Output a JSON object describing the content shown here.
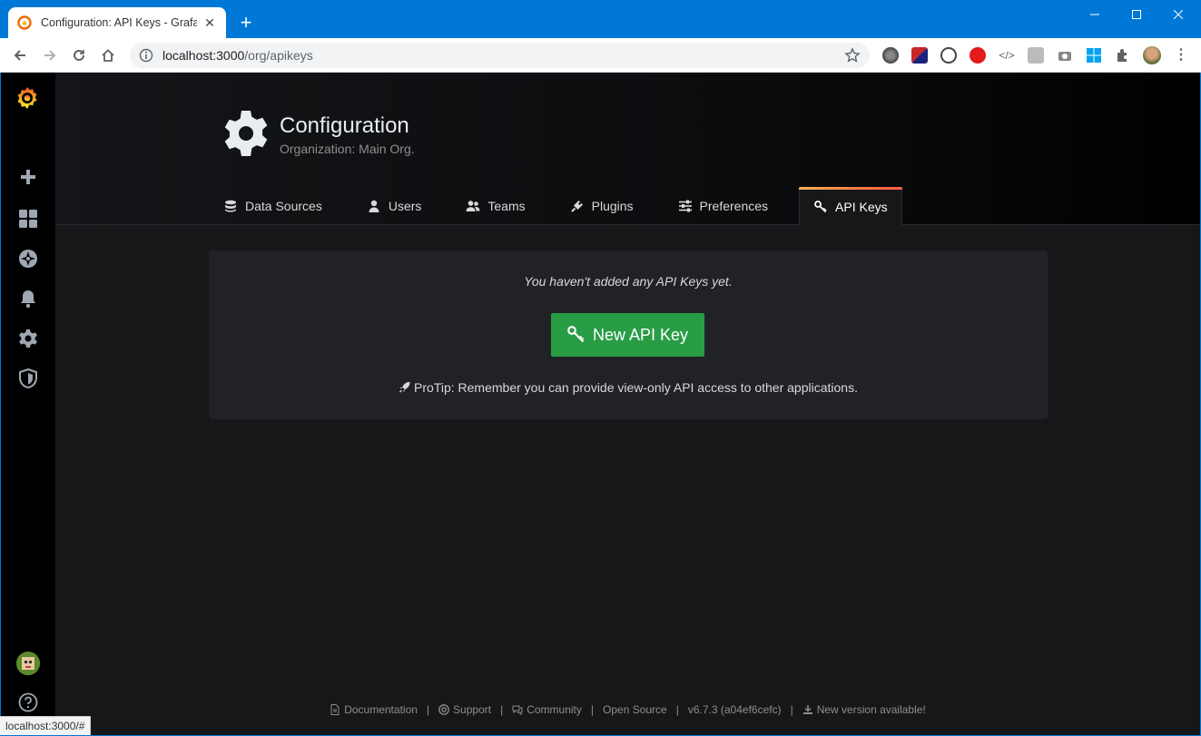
{
  "browser": {
    "tab_title": "Configuration: API Keys - Grafana",
    "url_host": "localhost:3000",
    "url_path": "/org/apikeys",
    "status_url": "localhost:3000/#"
  },
  "page": {
    "title": "Configuration",
    "subtitle": "Organization: Main Org."
  },
  "tabs": [
    {
      "label": "Data Sources",
      "icon": "database-icon"
    },
    {
      "label": "Users",
      "icon": "user-icon"
    },
    {
      "label": "Teams",
      "icon": "users-icon"
    },
    {
      "label": "Plugins",
      "icon": "plug-icon"
    },
    {
      "label": "Preferences",
      "icon": "sliders-icon"
    },
    {
      "label": "API Keys",
      "icon": "key-icon",
      "active": true
    }
  ],
  "empty_state": {
    "message": "You haven't added any API Keys yet.",
    "button_label": "New API Key",
    "protip": "ProTip: Remember you can provide view-only API access to other applications."
  },
  "footer": {
    "documentation": "Documentation",
    "support": "Support",
    "community": "Community",
    "open_source": "Open Source",
    "version": "v6.7.3 (a04ef6cefc)",
    "new_version": "New version available!"
  },
  "colors": {
    "primary_button": "#299c46",
    "accent_gradient": "#ff7941",
    "background": "#161719",
    "panel": "#202226"
  }
}
